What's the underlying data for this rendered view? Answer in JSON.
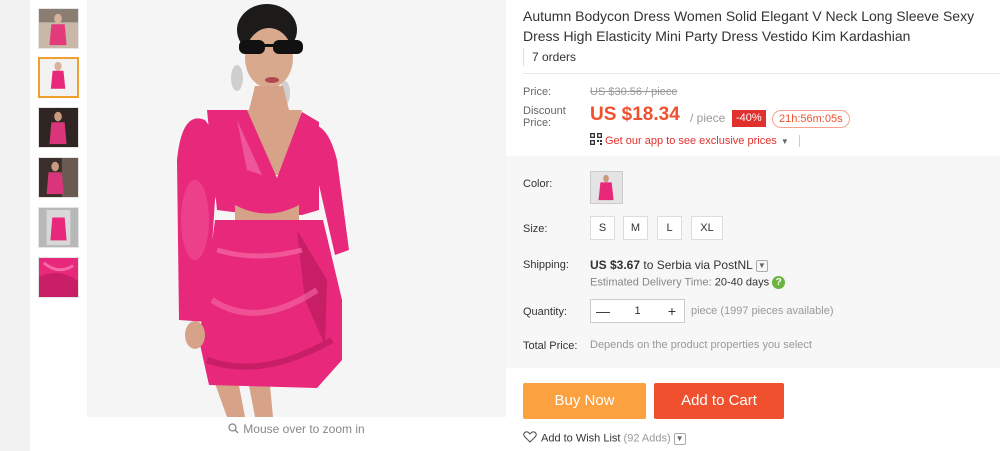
{
  "product": {
    "title": "Autumn Bodycon Dress Women Solid Elegant V Neck Long Sleeve Sexy Dress High Elasticity Mini Party Dress Vestido Kim Kardashian",
    "orders": "7 orders"
  },
  "gallery": {
    "zoom_hint": "Mouse over to zoom in",
    "thumbnails": [
      "thumb-1",
      "thumb-2",
      "thumb-3",
      "thumb-4",
      "thumb-5",
      "thumb-6"
    ],
    "active_index": 1
  },
  "price": {
    "label": "Price:",
    "original": "US $30.56 / piece",
    "discount_label": "Discount Price:",
    "current": "US $18.34",
    "per": "/ piece",
    "discount_badge": "-40%",
    "countdown": "21h:56m:05s",
    "app_promo": "Get our app to see exclusive prices"
  },
  "options": {
    "color_label": "Color:",
    "size_label": "Size:",
    "sizes": [
      "S",
      "M",
      "L",
      "XL"
    ]
  },
  "shipping": {
    "label": "Shipping:",
    "cost": "US $3.67",
    "to": "to Serbia via PostNL",
    "estimate_label": "Estimated Delivery Time:",
    "estimate_days": "20-40 days"
  },
  "quantity": {
    "label": "Quantity:",
    "value": "1",
    "available": "piece (1997 pieces available)"
  },
  "total": {
    "label": "Total Price:",
    "value": "Depends on the product properties you select"
  },
  "actions": {
    "buy_now": "Buy Now",
    "add_to_cart": "Add to Cart",
    "wishlist": "Add to Wish List",
    "wishlist_count": "(92 Adds)"
  },
  "colors": {
    "accent": "#f0502e",
    "buy_now": "#fba13f",
    "discount_badge": "#e0312e",
    "dress": "#e8287a"
  }
}
